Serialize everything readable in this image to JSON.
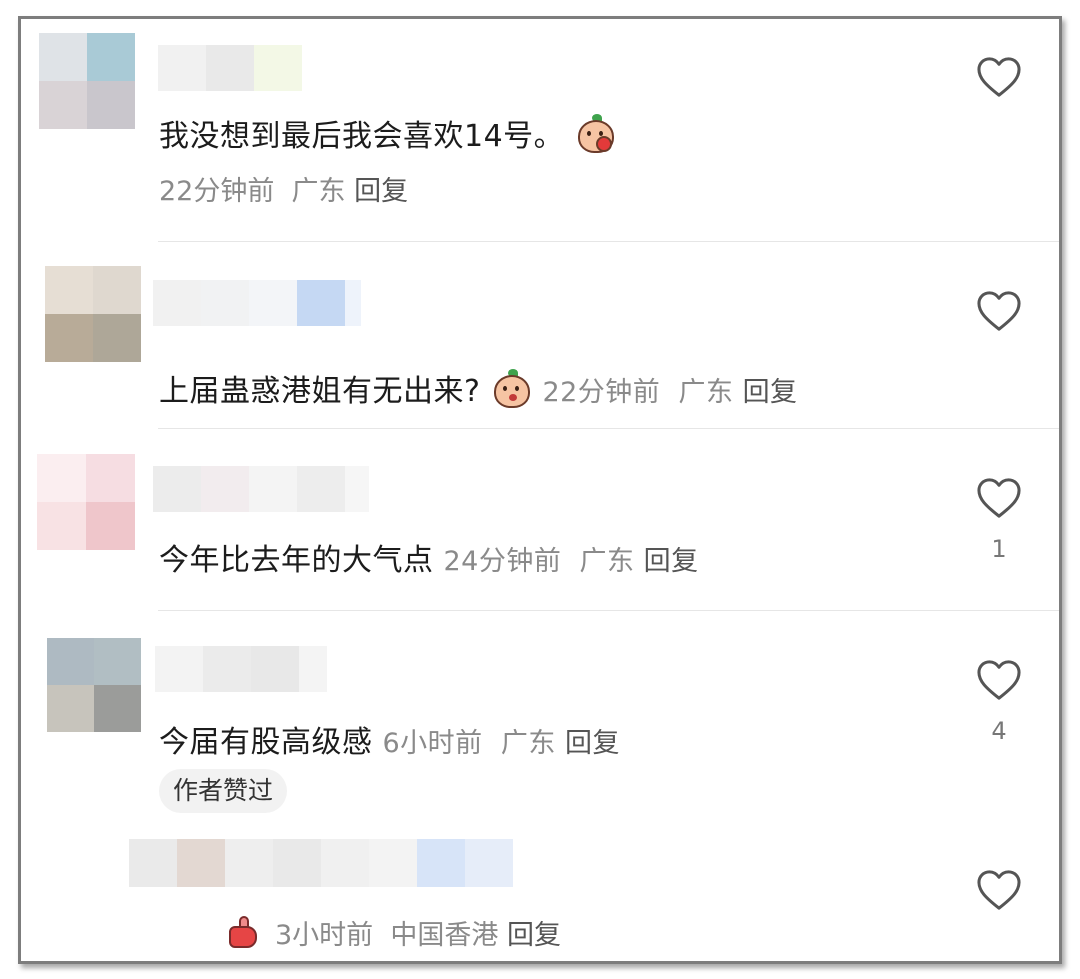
{
  "comments": [
    {
      "text": "我没想到最后我会喜欢14号。",
      "emoji": "blush-kiss-peach-emoji",
      "time": "22分钟前",
      "location": "广东",
      "reply": "回复",
      "likes": ""
    },
    {
      "text": "上届蛊惑港姐有无出来?",
      "emoji": "thinking-peach-emoji",
      "time": "22分钟前",
      "location": "广东",
      "reply": "回复",
      "likes": ""
    },
    {
      "text": "今年比去年的大气点",
      "time": "24分钟前",
      "location": "广东",
      "reply": "回复",
      "likes": "1"
    },
    {
      "text": "今届有股高级感",
      "time": "6小时前",
      "location": "广东",
      "reply": "回复",
      "likes": "4",
      "tag": "作者赞过"
    },
    {
      "emoji": "thumbs-up-emoji",
      "time": "3小时前",
      "location": "中国香港",
      "reply": "回复",
      "likes": ""
    }
  ],
  "icons": {
    "like": "heart-outline-icon"
  },
  "colors": {
    "meta_text": "#8a8a8a",
    "main_text": "#1c1c1c",
    "divider": "#e6e6e6",
    "tag_bg": "#f2f2f2"
  }
}
